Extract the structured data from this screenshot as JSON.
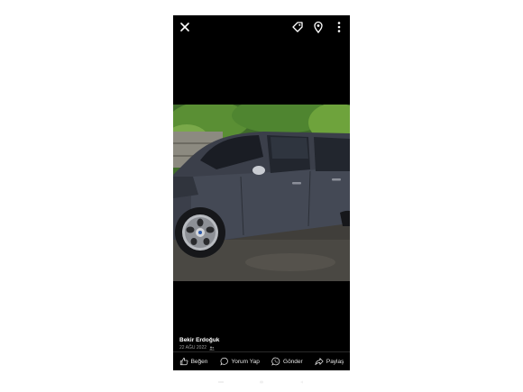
{
  "topbar": {
    "close_icon": "close-icon",
    "tag_icon": "tag-icon",
    "location_icon": "location-pin-icon",
    "more_icon": "more-vertical-icon"
  },
  "post": {
    "author": "Bekir Erdoğuk",
    "date": "22 AĞU 2022",
    "privacy_icon": "friends-icon"
  },
  "actions": {
    "like": "Beğen",
    "comment": "Yorum Yap",
    "send": "Gönder",
    "share": "Paylaş"
  },
  "colors": {
    "background": "#000000",
    "text": "#ffffff",
    "muted": "#9a9a9a"
  }
}
